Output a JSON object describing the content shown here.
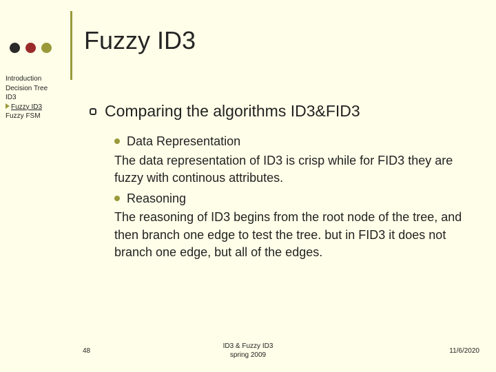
{
  "title": "Fuzzy ID3",
  "sidebar": {
    "items": [
      {
        "label": "Introduction"
      },
      {
        "label": "Decision Tree"
      },
      {
        "label": "ID3"
      },
      {
        "label": "Fuzzy ID3",
        "active": true
      },
      {
        "label": "Fuzzy FSM"
      }
    ]
  },
  "comparing": {
    "heading": "Comparing the algorithms ID3&FID3",
    "item1_label": "Data Representation",
    "item1_body": "The data representation of ID3 is crisp while for FID3 they are fuzzy with continous attributes.",
    "item2_label": "Reasoning",
    "item2_body": "The reasoning of ID3 begins from the root node of the tree, and then branch one edge to test the tree. but in FID3 it does not branch one edge, but all of the edges."
  },
  "footer": {
    "page": "48",
    "center_line1": "ID3 & Fuzzy ID3",
    "center_line2": "spring 2009",
    "date": "11/6/2020"
  }
}
